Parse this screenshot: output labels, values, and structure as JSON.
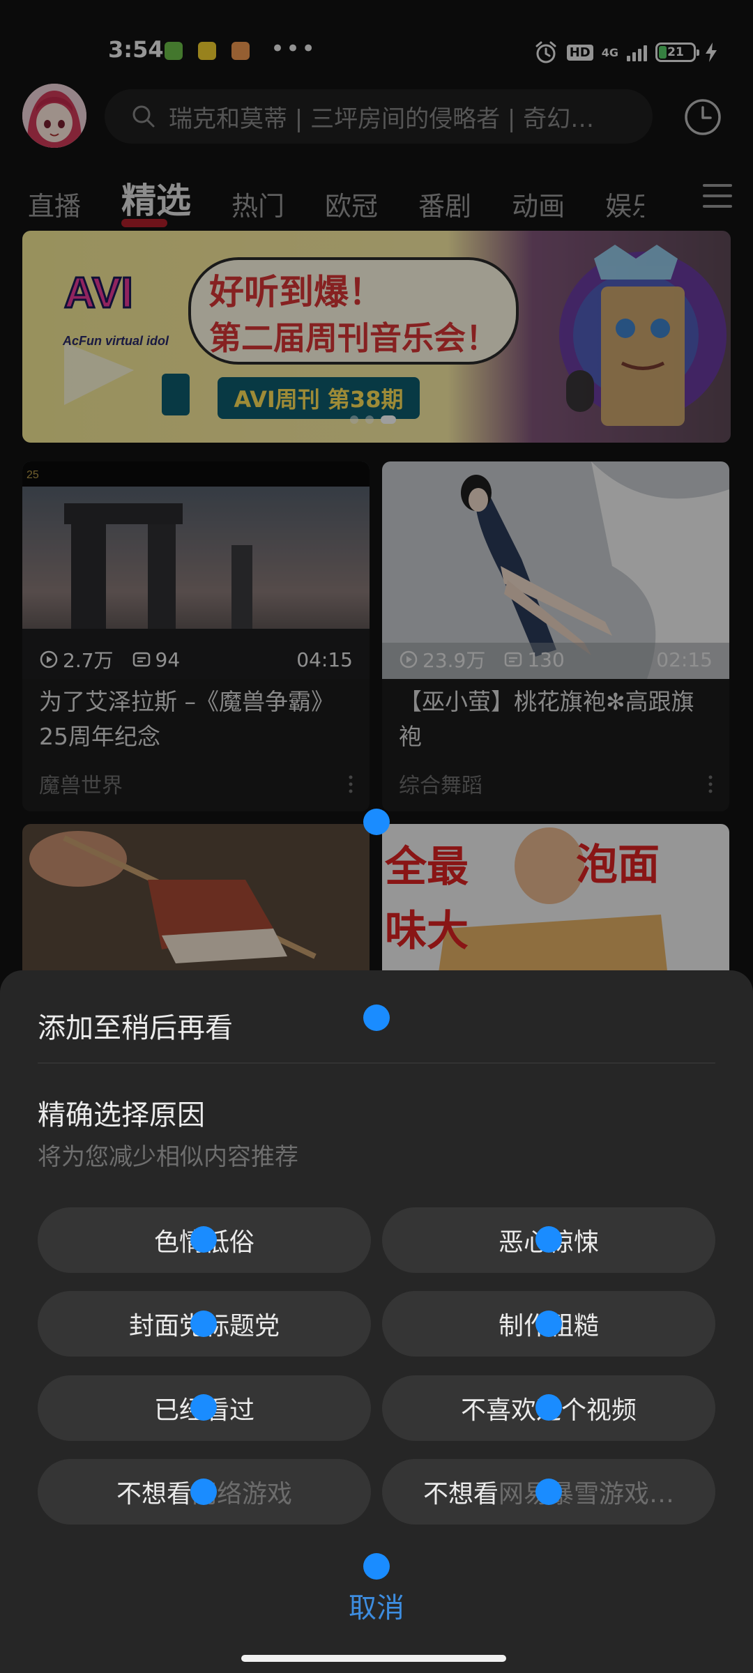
{
  "status_bar": {
    "time": "3:54",
    "network": "4G",
    "hd": "HD",
    "battery": "21",
    "battery_level": 0.21,
    "icons": [
      "app-notification-icon",
      "app-notification-icon",
      "app-notification-icon",
      "alarm-icon",
      "signal-icon",
      "battery-icon",
      "charging-icon"
    ]
  },
  "top_bar": {
    "search_placeholder": "瑞克和莫蒂 | 三坪房间的侵略者 | 奇幻…"
  },
  "tabs": [
    "直播",
    "精选",
    "热门",
    "欧冠",
    "番剧",
    "动画",
    "娱乐"
  ],
  "active_tab": 1,
  "banner": {
    "title": "好听到爆！",
    "subtitle": "第二届周刊音乐会！",
    "issue": "AVI周刊 第38期",
    "brand": "AcFun virtual idol",
    "slide_count": 3,
    "active_slide": 2
  },
  "feed": [
    {
      "views": "2.7万",
      "comments": "94",
      "duration": "04:15",
      "title": "为了艾泽拉斯 –《魔兽争霸》25周年纪念",
      "category": "魔兽世界"
    },
    {
      "views": "23.9万",
      "comments": "130",
      "duration": "02:15",
      "title": "【巫小萤】桃花旗袍✻高跟旗袍",
      "category": "综合舞蹈"
    }
  ],
  "feed_partial": [
    {
      "thumb_text": "全最 味大"
    },
    {
      "thumb_text": "泡面"
    }
  ],
  "sheet": {
    "watch_later": "添加至稍后再看",
    "reason_title": "精确选择原因",
    "reason_subtitle": "将为您减少相似内容推荐",
    "reasons": [
      {
        "label": "色情低俗",
        "muted": ""
      },
      {
        "label": "恶心惊悚",
        "muted": ""
      },
      {
        "label": "封面党标题党",
        "muted": ""
      },
      {
        "label": "制作粗糙",
        "muted": ""
      },
      {
        "label": "已经看过",
        "muted": ""
      },
      {
        "label": "不喜欢这个视频",
        "muted": ""
      },
      {
        "label": "不想看",
        "muted": "网络游戏"
      },
      {
        "label": "不想看",
        "muted": "网易暴雪游戏…"
      }
    ],
    "cancel": "取消"
  },
  "colors": {
    "accent": "#3d8de0",
    "tab_indicator": "#b2202a",
    "sheet_bg": "#262626",
    "tap_marker": "#1a8cff"
  }
}
